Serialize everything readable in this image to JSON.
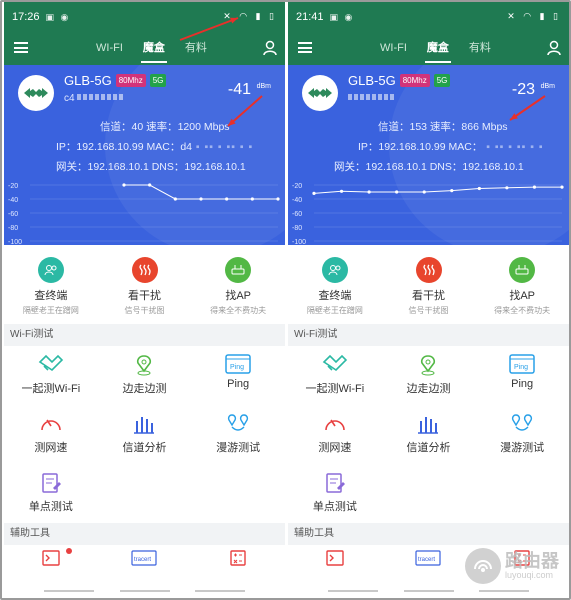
{
  "screens": [
    {
      "time": "17:26",
      "tabs": [
        "WI-FI",
        "魔盒",
        "有料"
      ],
      "ssid": "GLB-5G",
      "bandwidth": "80Mhz",
      "band": "5G",
      "rssi": "-41",
      "unit": "dBm",
      "channel_rate": "信道：40  速率：1200 Mbps",
      "ip_mac": "IP：192.168.10.99  MAC：d4",
      "gateway_dns": "网关：192.168.10.1   DNS：192.168.10.1",
      "mac_prefix": "c4",
      "chart_axis": [
        "-20",
        "-40",
        "-60",
        "-80",
        "-100"
      ]
    },
    {
      "time": "21:41",
      "tabs": [
        "WI-FI",
        "魔盒",
        "有料"
      ],
      "ssid": "GLB-5G",
      "bandwidth": "80Mhz",
      "band": "5G",
      "rssi": "-23",
      "unit": "dBm",
      "channel_rate": "信道：153  速率：866 Mbps",
      "ip_mac": "IP：192.168.10.99  MAC：",
      "gateway_dns": "网关：192.168.10.1   DNS：192.168.10.1",
      "mac_prefix": "",
      "chart_axis": [
        "-20",
        "-40",
        "-60",
        "-80",
        "-100"
      ]
    }
  ],
  "top_tools": [
    {
      "label": "查终端",
      "sub": "隔壁老王在蹭网",
      "color": "#2bb9a4"
    },
    {
      "label": "看干扰",
      "sub": "信号干扰图",
      "color": "#e8452d"
    },
    {
      "label": "找AP",
      "sub": "得来全不费功夫",
      "color": "#52b845"
    }
  ],
  "section_wifi": "Wi-Fi测试",
  "wifi_tools": [
    "一起测Wi-Fi",
    "边走边测",
    "Ping",
    "测网速",
    "信道分析",
    "漫游测试",
    "单点测试"
  ],
  "section_aux": "辅助工具",
  "aux_tools": [
    "terminal-icon",
    "tracert",
    "calculator-icon"
  ],
  "watermark": {
    "title": "路由器",
    "sub": "luyouqi.com"
  },
  "chart_data": [
    {
      "type": "line",
      "ylim": [
        -100,
        -20
      ],
      "y_ticks": [
        -20,
        -40,
        -60,
        -80,
        -100
      ],
      "x": [
        1,
        2,
        3,
        4,
        5,
        6,
        7
      ],
      "values": [
        -20,
        -20,
        -40,
        -40,
        -40,
        -40,
        -40
      ]
    },
    {
      "type": "line",
      "ylim": [
        -100,
        -20
      ],
      "y_ticks": [
        -20,
        -40,
        -60,
        -80,
        -100
      ],
      "x": [
        1,
        2,
        3,
        4,
        5,
        6,
        7,
        8,
        9,
        10
      ],
      "values": [
        -32,
        -29,
        -30,
        -30,
        -30,
        -28,
        -25,
        -24,
        -23,
        -23
      ]
    }
  ]
}
